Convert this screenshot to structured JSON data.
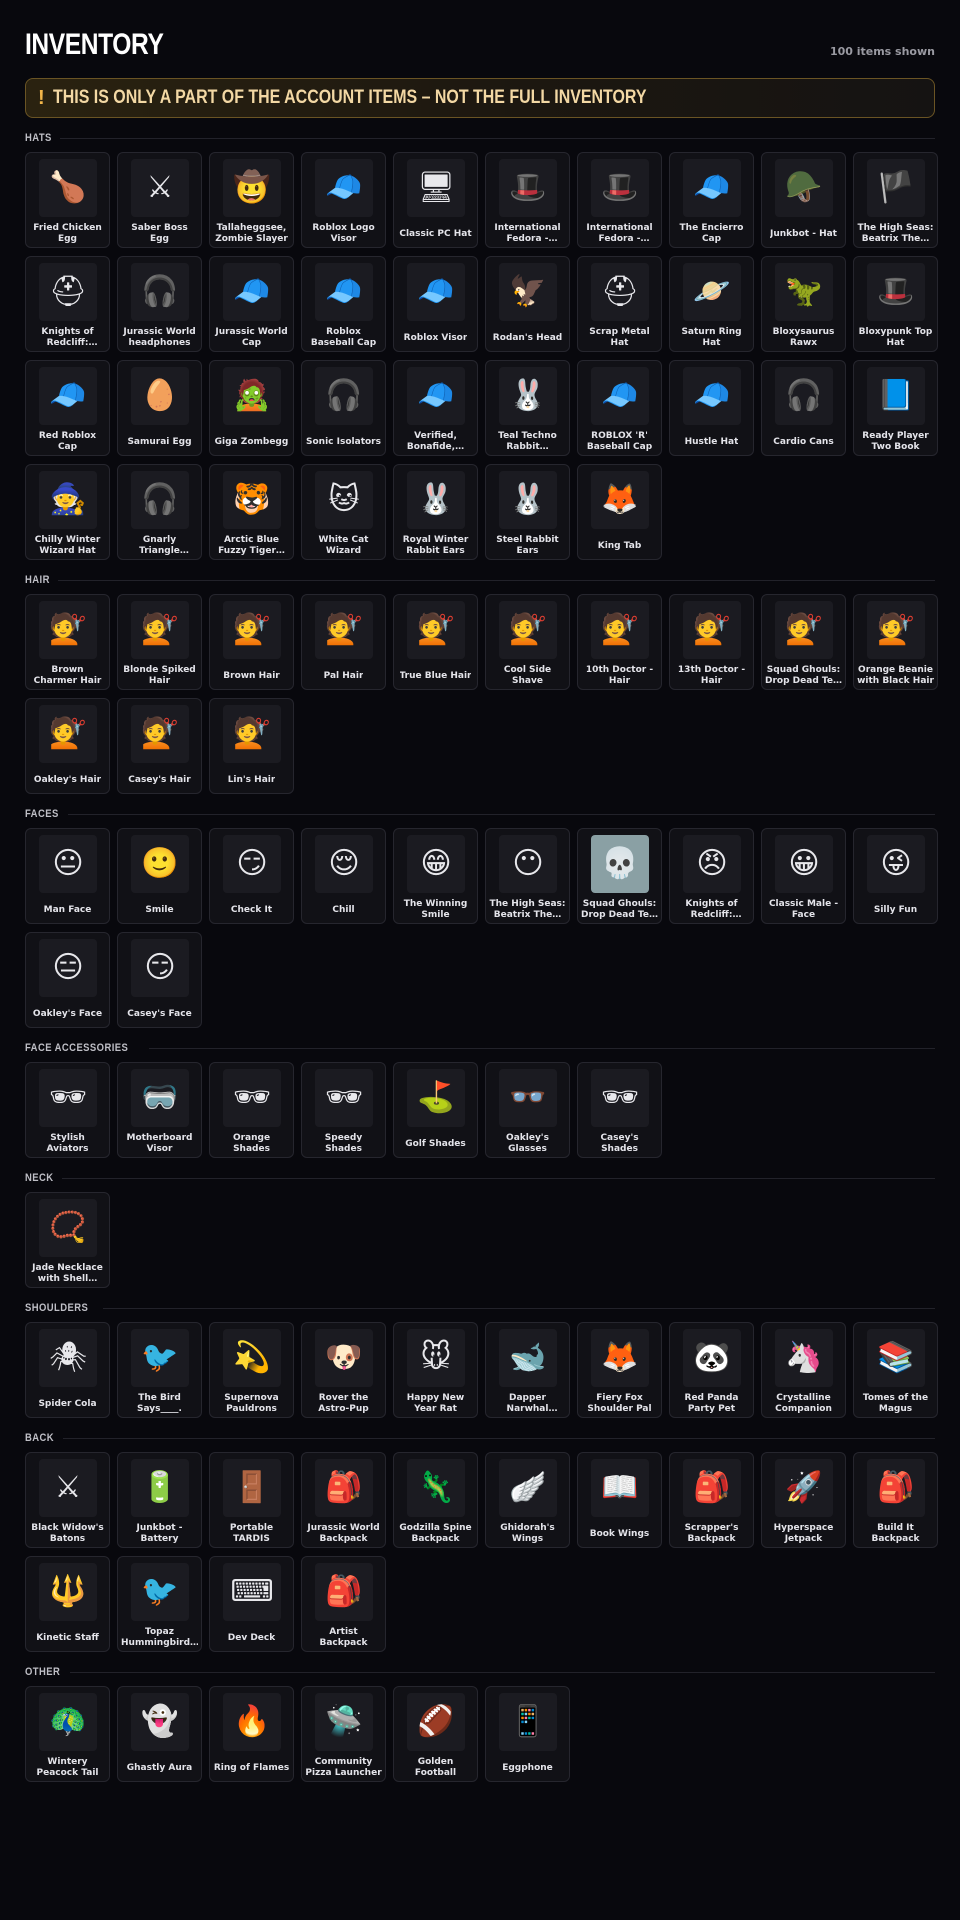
{
  "page": {
    "title": "INVENTORY",
    "count": "100 items shown",
    "banner_icon": "!",
    "banner_text": "THIS IS ONLY A PART OF THE ACCOUNT ITEMS – NOT THE FULL INVENTORY"
  },
  "colors": {
    "background": "#08080d",
    "card": "#111116",
    "banner_border": "#6a5424",
    "banner_text": "#f3d8a4",
    "accent": "#f2b64a"
  },
  "sections": [
    {
      "title": "HATS",
      "items": [
        {
          "name": "Fried Chicken Egg",
          "icon": "🍗"
        },
        {
          "name": "Saber Boss Egg",
          "icon": "⚔"
        },
        {
          "name": "Tallaheggsee, Zombie Slayer",
          "icon": "🤠"
        },
        {
          "name": "Roblox Logo Visor",
          "icon": "🧢"
        },
        {
          "name": "Classic PC Hat",
          "icon": "🖥"
        },
        {
          "name": "International Fedora - France",
          "icon": "🎩"
        },
        {
          "name": "International Fedora - Turkey",
          "icon": "🎩"
        },
        {
          "name": "The Encierro Cap",
          "icon": "🧢"
        },
        {
          "name": "Junkbot - Hat",
          "icon": "🪖"
        },
        {
          "name": "The High Seas: Beatrix The…",
          "icon": "🏴"
        },
        {
          "name": "Knights of Redcliff: Palad…",
          "icon": "⛑"
        },
        {
          "name": "Jurassic World headphones",
          "icon": "🎧"
        },
        {
          "name": "Jurassic World Cap",
          "icon": "🧢"
        },
        {
          "name": "Roblox Baseball Cap",
          "icon": "🧢"
        },
        {
          "name": "Roblox Visor",
          "icon": "🧢"
        },
        {
          "name": "Rodan's Head",
          "icon": "🦅"
        },
        {
          "name": "Scrap Metal Hat",
          "icon": "⛑"
        },
        {
          "name": "Saturn Ring Hat",
          "icon": "🪐"
        },
        {
          "name": "Bloxysaurus Rawx",
          "icon": "🦖"
        },
        {
          "name": "Bloxypunk Top Hat",
          "icon": "🎩"
        },
        {
          "name": "Red Roblox Cap",
          "icon": "🧢"
        },
        {
          "name": "Samurai Egg",
          "icon": "🥚"
        },
        {
          "name": "Giga Zombegg",
          "icon": "🧟"
        },
        {
          "name": "Sonic Isolators",
          "icon": "🎧"
        },
        {
          "name": "Verified, Bonafide,…",
          "icon": "🧢"
        },
        {
          "name": "Teal Techno Rabbit…",
          "icon": "🐰"
        },
        {
          "name": "ROBLOX 'R' Baseball Cap",
          "icon": "🧢"
        },
        {
          "name": "Hustle Hat",
          "icon": "🧢"
        },
        {
          "name": "Cardio Cans",
          "icon": "🎧"
        },
        {
          "name": "Ready Player Two Book",
          "icon": "📘"
        },
        {
          "name": "Chilly Winter Wizard Hat",
          "icon": "🧙"
        },
        {
          "name": "Gnarly Triangle Headphones",
          "icon": "🎧"
        },
        {
          "name": "Arctic Blue Fuzzy Tiger…",
          "icon": "🐯"
        },
        {
          "name": "White Cat Wizard",
          "icon": "🐱"
        },
        {
          "name": "Royal Winter Rabbit Ears",
          "icon": "🐰"
        },
        {
          "name": "Steel Rabbit Ears",
          "icon": "🐰"
        },
        {
          "name": "King Tab",
          "icon": "🦊"
        }
      ]
    },
    {
      "title": "HAIR",
      "items": [
        {
          "name": "Brown Charmer Hair",
          "icon": "💇"
        },
        {
          "name": "Blonde Spiked Hair",
          "icon": "💇"
        },
        {
          "name": "Brown Hair",
          "icon": "💇"
        },
        {
          "name": "Pal Hair",
          "icon": "💇"
        },
        {
          "name": "True Blue Hair",
          "icon": "💇"
        },
        {
          "name": "Cool Side Shave",
          "icon": "💇"
        },
        {
          "name": "10th Doctor - Hair",
          "icon": "💇"
        },
        {
          "name": "13th Doctor - Hair",
          "icon": "💇"
        },
        {
          "name": "Squad Ghouls: Drop Dead Te…",
          "icon": "💇"
        },
        {
          "name": "Orange Beanie with Black Hair",
          "icon": "💇"
        },
        {
          "name": "Oakley's Hair",
          "icon": "💇"
        },
        {
          "name": "Casey's Hair",
          "icon": "💇"
        },
        {
          "name": "Lin's Hair",
          "icon": "💇"
        }
      ]
    },
    {
      "title": "FACES",
      "items": [
        {
          "name": "Man Face",
          "icon": "😐"
        },
        {
          "name": "Smile",
          "icon": "🙂"
        },
        {
          "name": "Check It",
          "icon": "😏"
        },
        {
          "name": "Chill",
          "icon": "😌"
        },
        {
          "name": "The Winning Smile",
          "icon": "😁"
        },
        {
          "name": "The High Seas: Beatrix The…",
          "icon": "😶"
        },
        {
          "name": "Squad Ghouls: Drop Dead Te…",
          "icon": "💀",
          "light": true
        },
        {
          "name": "Knights of Redcliff: Palad…",
          "icon": "😠"
        },
        {
          "name": "Classic Male - Face",
          "icon": "😀"
        },
        {
          "name": "Silly Fun",
          "icon": "😜"
        },
        {
          "name": "Oakley's Face",
          "icon": "😑"
        },
        {
          "name": "Casey's Face",
          "icon": "😏"
        }
      ]
    },
    {
      "title": "FACE ACCESSORIES",
      "items": [
        {
          "name": "Stylish Aviators",
          "icon": "🕶"
        },
        {
          "name": "Motherboard Visor",
          "icon": "🥽"
        },
        {
          "name": "Orange Shades",
          "icon": "🕶"
        },
        {
          "name": "Speedy Shades",
          "icon": "🕶"
        },
        {
          "name": "Golf Shades",
          "icon": "⛳"
        },
        {
          "name": "Oakley's Glasses",
          "icon": "👓"
        },
        {
          "name": "Casey's Shades",
          "icon": "🕶"
        }
      ]
    },
    {
      "title": "NECK",
      "items": [
        {
          "name": "Jade Necklace with Shell…",
          "icon": "📿"
        }
      ]
    },
    {
      "title": "SHOULDERS",
      "items": [
        {
          "name": "Spider Cola",
          "icon": "🕷"
        },
        {
          "name": "The Bird Says____.",
          "icon": "🐦"
        },
        {
          "name": "Supernova Pauldrons",
          "icon": "💫"
        },
        {
          "name": "Rover the Astro-Pup",
          "icon": "🐶"
        },
        {
          "name": "Happy New Year Rat",
          "icon": "🐭"
        },
        {
          "name": "Dapper Narwhal Shoulder Pal",
          "icon": "🐋"
        },
        {
          "name": "Fiery Fox Shoulder Pal",
          "icon": "🦊"
        },
        {
          "name": "Red Panda Party Pet",
          "icon": "🐼"
        },
        {
          "name": "Crystalline Companion",
          "icon": "🦄"
        },
        {
          "name": "Tomes of the Magus",
          "icon": "📚"
        }
      ]
    },
    {
      "title": "BACK",
      "items": [
        {
          "name": "Black Widow's Batons",
          "icon": "⚔"
        },
        {
          "name": "Junkbot - Battery",
          "icon": "🔋"
        },
        {
          "name": "Portable TARDIS",
          "icon": "🚪"
        },
        {
          "name": "Jurassic World Backpack",
          "icon": "🎒"
        },
        {
          "name": "Godzilla Spine Backpack",
          "icon": "🦎"
        },
        {
          "name": "Ghidorah's Wings",
          "icon": "🪽"
        },
        {
          "name": "Book Wings",
          "icon": "📖"
        },
        {
          "name": "Scrapper's Backpack",
          "icon": "🎒"
        },
        {
          "name": "Hyperspace Jetpack",
          "icon": "🚀"
        },
        {
          "name": "Build It Backpack",
          "icon": "🎒"
        },
        {
          "name": "Kinetic Staff",
          "icon": "🔱"
        },
        {
          "name": "Topaz Hummingbird…",
          "icon": "🐦"
        },
        {
          "name": "Dev Deck",
          "icon": "⌨"
        },
        {
          "name": "Artist Backpack",
          "icon": "🎒"
        }
      ]
    },
    {
      "title": "OTHER",
      "items": [
        {
          "name": "Wintery Peacock Tail",
          "icon": "🦚"
        },
        {
          "name": "Ghastly Aura",
          "icon": "👻"
        },
        {
          "name": "Ring of Flames",
          "icon": "🔥"
        },
        {
          "name": "Community Pizza Launcher",
          "icon": "🛸"
        },
        {
          "name": "Golden Football",
          "icon": "🏈"
        },
        {
          "name": "Eggphone",
          "icon": "📱"
        }
      ]
    }
  ]
}
